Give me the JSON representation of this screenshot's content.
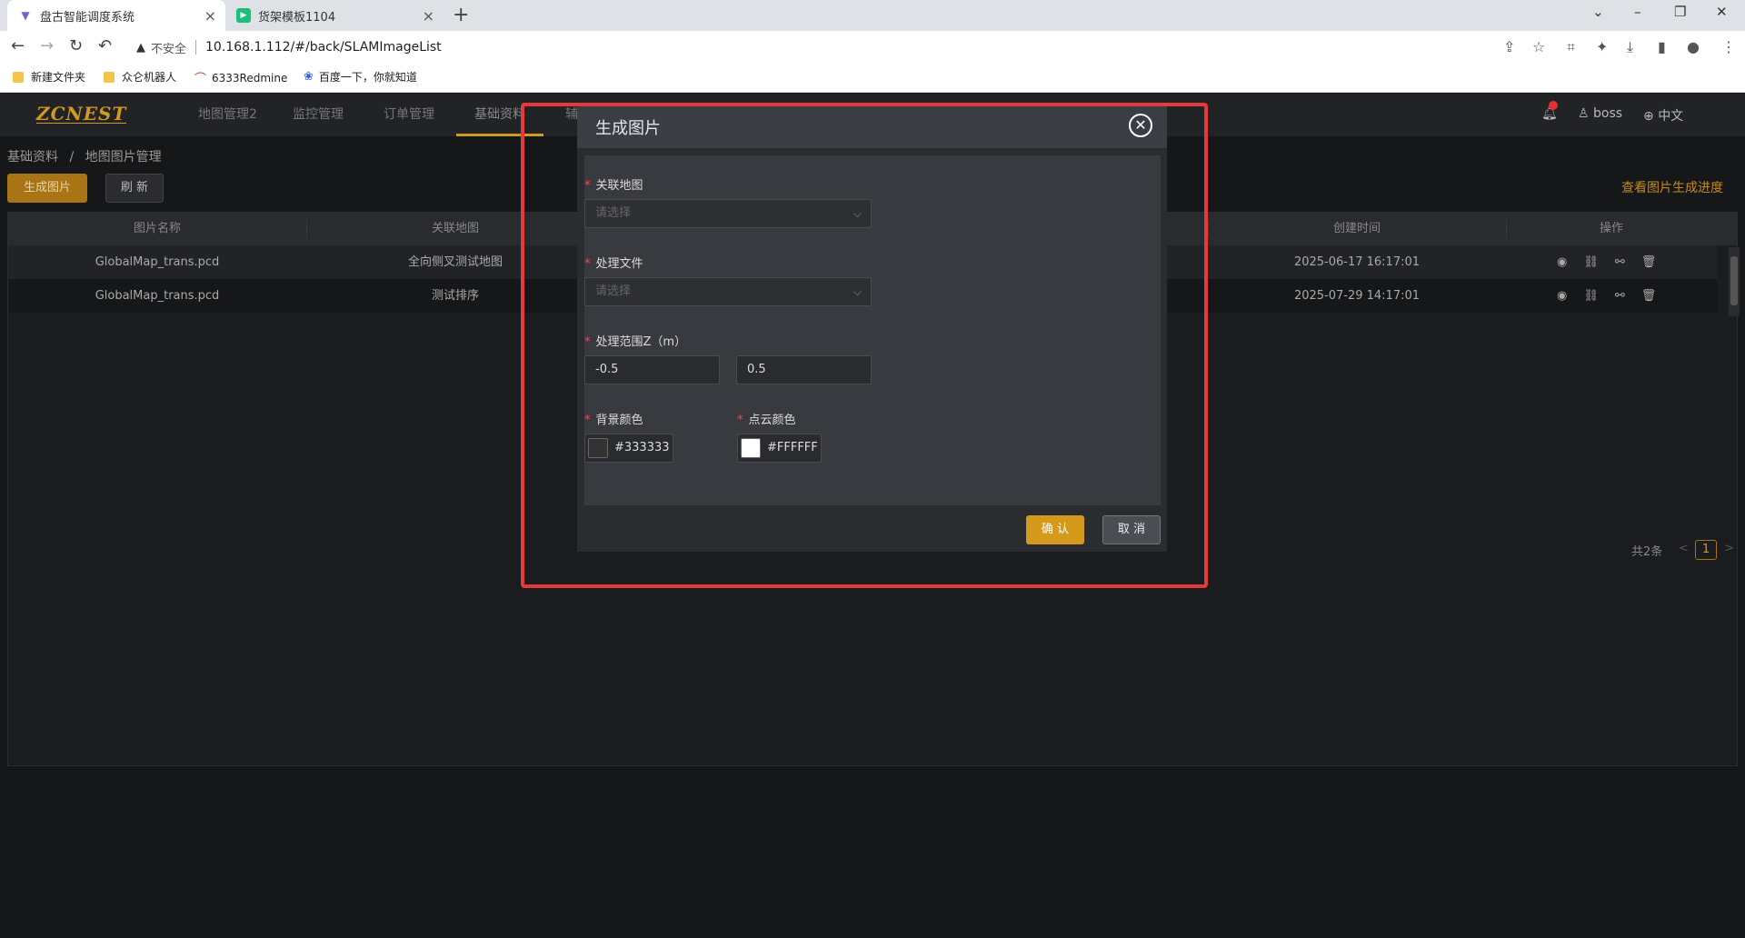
{
  "browser": {
    "tabs": [
      {
        "title": "盘古智能调度系统",
        "icon": "vuetify-icon"
      },
      {
        "title": "货架模板1104",
        "icon": "play-icon"
      }
    ],
    "new_tab": "+",
    "url_warning": "不安全",
    "url": "10.168.1.112/#/back/SLAMImageList",
    "bookmarks": [
      "新建文件夹",
      "众仑机器人",
      "6333Redmine",
      "百度一下，你就知道"
    ]
  },
  "app": {
    "logo": "ZCNEST",
    "nav": [
      "地图管理2",
      "监控管理",
      "订单管理",
      "基础资料",
      "辅"
    ],
    "user": "boss",
    "language": "中文",
    "breadcrumb": [
      "基础资料",
      "地图图片管理"
    ],
    "breadcrumb_sep": "/",
    "generate_button": "生成图片",
    "refresh_button": "刷 新",
    "progress_link": "查看图片生成进度",
    "table": {
      "columns": [
        "图片名称",
        "关联地图",
        "创建时间",
        "操作"
      ],
      "rows": [
        {
          "name": "GlobalMap_trans.pcd",
          "map": "全向侧叉测试地图",
          "created": "2025-06-17 16:17:01"
        },
        {
          "name": "GlobalMap_trans.pcd",
          "map": "测试排序",
          "created": "2025-07-29 14:17:01"
        }
      ]
    },
    "pagination": {
      "total": "共2条",
      "current": "1",
      "prev": "<",
      "next": ">"
    }
  },
  "modal": {
    "title": "生成图片",
    "close": "✕",
    "fields": {
      "map_label": "关联地图",
      "map_placeholder": "请选择",
      "file_label": "处理文件",
      "file_placeholder": "请选择",
      "range_label": "处理范围Z（m）",
      "range_min": "-0.5",
      "range_max": "0.5",
      "bg_color_label": "背景颜色",
      "bg_color": "#333333",
      "cloud_color_label": "点云颜色",
      "cloud_color": "#FFFFFF"
    },
    "confirm": "确 认",
    "cancel": "取 消"
  },
  "colors": {
    "accent": "#d59a1c",
    "highlight": "#e63a3a"
  }
}
